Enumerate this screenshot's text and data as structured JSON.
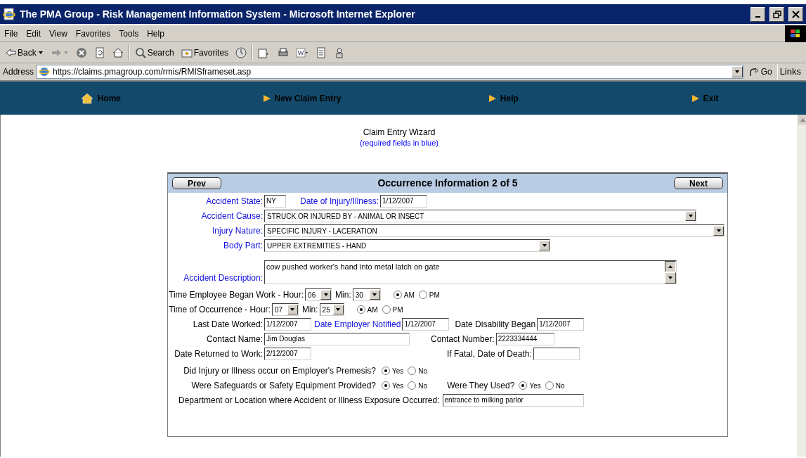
{
  "window": {
    "title": "The PMA Group - Risk Management Information System - Microsoft Internet Explorer"
  },
  "menu": [
    "File",
    "Edit",
    "View",
    "Favorites",
    "Tools",
    "Help"
  ],
  "toolbar": [
    {
      "kind": "back",
      "label": "Back"
    },
    {
      "kind": "forward"
    },
    {
      "kind": "stop"
    },
    {
      "kind": "refresh"
    },
    {
      "kind": "home"
    },
    {
      "kind": "search",
      "label": "Search"
    },
    {
      "kind": "favorites",
      "label": "Favorites"
    },
    {
      "kind": "history"
    },
    {
      "kind": "mail"
    },
    {
      "kind": "print"
    },
    {
      "kind": "edit"
    },
    {
      "kind": "discuss"
    },
    {
      "kind": "messenger"
    }
  ],
  "address": {
    "label": "Address",
    "url": "https://claims.pmagroup.com/rmis/RMISframeset.asp",
    "go": "Go",
    "links": "Links"
  },
  "site_nav": [
    {
      "kind": "home",
      "label": "Home"
    },
    {
      "kind": "arrow",
      "label": "New Claim Entry"
    },
    {
      "kind": "arrow",
      "label": "Help"
    },
    {
      "kind": "arrow",
      "label": "Exit"
    }
  ],
  "wizard": {
    "title": "Claim Entry Wizard",
    "note": "(required fields in blue)"
  },
  "panel": {
    "prev": "Prev",
    "heading": "Occurrence Information 2 of 5",
    "next": "Next",
    "rows": [
      [
        {
          "kind": "label",
          "text": "Accident State:",
          "required": true
        },
        {
          "kind": "text",
          "value": "NY"
        },
        {
          "kind": "label",
          "text": "Date of Injury/Illness:",
          "required": true
        },
        {
          "kind": "text",
          "value": "1/12/2007"
        }
      ],
      [
        {
          "kind": "label",
          "text": "Accident Cause:",
          "required": true
        },
        {
          "kind": "select",
          "value": "STRUCK OR INJURED BY  - ANIMAL OR INSECT"
        }
      ],
      [
        {
          "kind": "label",
          "text": "Injury Nature:",
          "required": true
        },
        {
          "kind": "select",
          "value": "SPECIFIC INJURY  - LACERATION"
        }
      ],
      [
        {
          "kind": "label",
          "text": "Body Part:",
          "required": true
        },
        {
          "kind": "select",
          "value": "UPPER EXTREMITIES  - HAND"
        }
      ],
      [
        {
          "kind": "label",
          "text": "Accident Description:",
          "required": true
        },
        {
          "kind": "textarea",
          "value": "cow pushed worker's hand into metal latch on gate"
        }
      ],
      [
        {
          "kind": "label",
          "text": "Time Employee Began Work - Hour:",
          "required": false
        },
        {
          "kind": "select",
          "value": "06"
        },
        {
          "kind": "label",
          "text": "Min:",
          "required": false
        },
        {
          "kind": "select",
          "value": "30"
        },
        {
          "kind": "radio",
          "options": [
            {
              "label": "AM",
              "selected": true
            },
            {
              "label": "PM",
              "selected": false
            }
          ]
        }
      ],
      [
        {
          "kind": "label",
          "text": "Time of Occurrence - Hour:",
          "required": false
        },
        {
          "kind": "select",
          "value": "07"
        },
        {
          "kind": "label",
          "text": "Min:",
          "required": false
        },
        {
          "kind": "select",
          "value": "25"
        },
        {
          "kind": "radio",
          "options": [
            {
              "label": "AM",
              "selected": true
            },
            {
              "label": "PM",
              "selected": false
            }
          ]
        }
      ],
      [
        {
          "kind": "label",
          "text": "Last Date Worked:",
          "required": false
        },
        {
          "kind": "text",
          "value": "1/12/2007"
        },
        {
          "kind": "label",
          "text": "Date Employer Notified",
          "required": true
        },
        {
          "kind": "text",
          "value": "1/12/2007"
        },
        {
          "kind": "label",
          "text": "Date Disability Began",
          "required": false
        },
        {
          "kind": "text",
          "value": "1/12/2007"
        }
      ],
      [
        {
          "kind": "label",
          "text": "Contact Name:",
          "required": false
        },
        {
          "kind": "text",
          "value": "Jim Douglas"
        },
        {
          "kind": "label",
          "text": "Contact Number:",
          "required": false
        },
        {
          "kind": "text",
          "value": "2223334444"
        }
      ],
      [
        {
          "kind": "label",
          "text": "Date Returned to Work:",
          "required": false
        },
        {
          "kind": "text",
          "value": "2/12/2007"
        },
        {
          "kind": "label",
          "text": "If Fatal, Date of Death:",
          "required": false
        },
        {
          "kind": "text"
        }
      ],
      [
        {
          "kind": "label",
          "text": "Did Injury or Illness occur on Employer's Premesis?",
          "required": false
        },
        {
          "kind": "radio",
          "options": [
            {
              "label": "Yes",
              "selected": true
            },
            {
              "label": "No",
              "selected": false
            }
          ]
        }
      ],
      [
        {
          "kind": "label",
          "text": "Were Safeguards or Safety Equipment Provided?",
          "required": false
        },
        {
          "kind": "radio",
          "options": [
            {
              "label": "Yes",
              "selected": true
            },
            {
              "label": "No",
              "selected": false
            }
          ]
        },
        {
          "kind": "label",
          "text": "Were They Used?",
          "required": false
        },
        {
          "kind": "radio",
          "options": [
            {
              "label": "Yes",
              "selected": true
            },
            {
              "label": "No",
              "selected": false
            }
          ]
        }
      ],
      [
        {
          "kind": "label",
          "text": "Department or Location where Accident or Illness Exposure Occurred:",
          "required": false
        },
        {
          "kind": "text",
          "value": "entrance to milking parlor"
        }
      ]
    ]
  }
}
